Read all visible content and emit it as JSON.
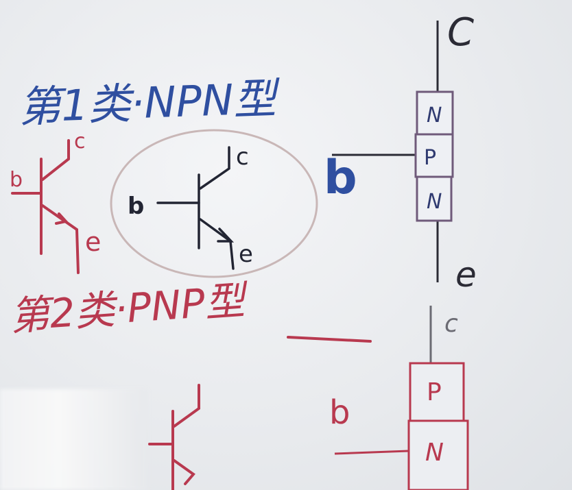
{
  "colors": {
    "blue_ink": "#2f4fa0",
    "red_ink": "#b8394f",
    "dark_ink": "#222533",
    "board": "#eceef1"
  },
  "headings": {
    "npn_title": "第1类·NPN型",
    "pnp_title": "第2类·PNP型"
  },
  "npn_symbol_small": {
    "b": "b",
    "c": "c",
    "e": "e"
  },
  "npn_symbol_circled": {
    "b": "b",
    "c": "c",
    "e": "e"
  },
  "npn_structure": {
    "collector": "C",
    "base": "b",
    "emitter": "e",
    "layers": [
      "N",
      "P",
      "N"
    ]
  },
  "pnp_structure": {
    "collector": "c",
    "base": "b",
    "layers": [
      "P",
      "N"
    ]
  }
}
